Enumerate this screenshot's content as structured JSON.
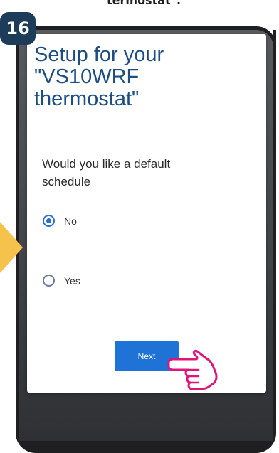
{
  "header": {
    "caption": "termostat\".",
    "step_number": "16"
  },
  "dialog": {
    "title_lines": [
      "Setup for your",
      "\"VS10WRF",
      "thermostat\""
    ],
    "question_lines": [
      "Would you like a default",
      "schedule"
    ],
    "options": [
      {
        "label": "No",
        "selected": true
      },
      {
        "label": "Yes",
        "selected": false
      }
    ],
    "next_label": "Next"
  },
  "colors": {
    "badge": "#1d3c5a",
    "title": "#1c4e86",
    "accent": "#1f73d6",
    "arrow": "#f5c24c",
    "hand_outline": "#e0157a"
  },
  "icons": {
    "pointer": "hand-pointer-icon",
    "step_arrow": "arrow-right-icon"
  }
}
